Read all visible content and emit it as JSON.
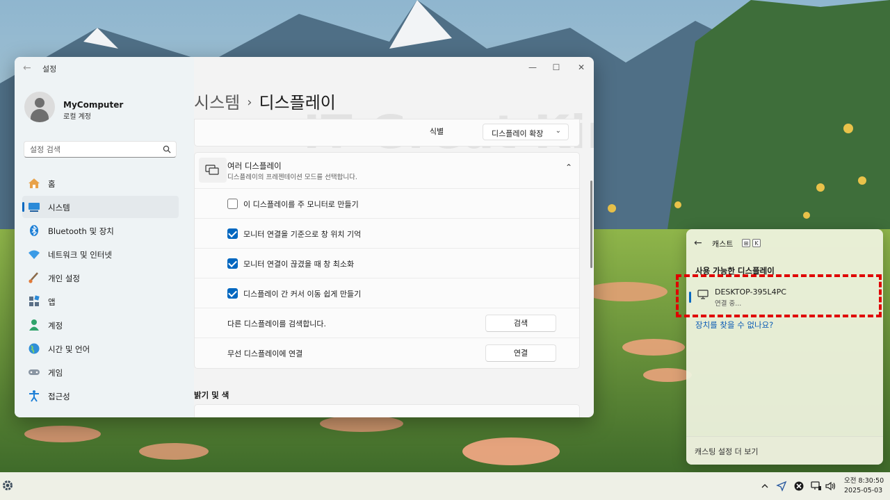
{
  "window": {
    "title": "설정",
    "minimize_glyph": "—",
    "maximize_glyph": "☐",
    "close_glyph": "✕"
  },
  "profile": {
    "name": "MyComputer",
    "account_type": "로컬 계정"
  },
  "search": {
    "placeholder": "설정 검색"
  },
  "nav": {
    "items": [
      {
        "label": "홈",
        "icon": "home-icon",
        "active": false
      },
      {
        "label": "시스템",
        "icon": "system-icon",
        "active": true
      },
      {
        "label": "Bluetooth 및 장치",
        "icon": "bluetooth-icon",
        "active": false
      },
      {
        "label": "네트워크 및 인터넷",
        "icon": "network-icon",
        "active": false
      },
      {
        "label": "개인 설정",
        "icon": "personalization-icon",
        "active": false
      },
      {
        "label": "앱",
        "icon": "apps-icon",
        "active": false
      },
      {
        "label": "계정",
        "icon": "account-icon",
        "active": false
      },
      {
        "label": "시간 및 언어",
        "icon": "globe-icon",
        "active": false
      },
      {
        "label": "게임",
        "icon": "gamepad-icon",
        "active": false
      },
      {
        "label": "접근성",
        "icon": "accessibility-icon",
        "active": false
      }
    ]
  },
  "breadcrumb": {
    "parent": "시스템",
    "separator": "›",
    "current": "디스플레이"
  },
  "watermark": "IT Great King",
  "top_card": {
    "identify_label": "식별",
    "arrangement_value": "디스플레이 확장",
    "chevron": "⌄"
  },
  "multi_display": {
    "title": "여러 디스플레이",
    "subtitle": "디스플레이의 프레젠테이션 모드를 선택합니다.",
    "chevron": "⌃",
    "checkboxes": [
      {
        "label": "이 디스플레이를 주 모니터로 만들기",
        "checked": false
      },
      {
        "label": "모니터 연결을 기준으로 창 위치 기억",
        "checked": true
      },
      {
        "label": "모니터 연결이 끊겼을 때 창 최소화",
        "checked": true
      },
      {
        "label": "디스플레이 간 커서 이동 쉽게 만들기",
        "checked": true
      }
    ],
    "detect": {
      "label": "다른 디스플레이를 검색합니다.",
      "button": "검색"
    },
    "wireless": {
      "label": "무선 디스플레이에 연결",
      "button": "연결"
    }
  },
  "brightness_section": {
    "title": "밝기 및 색"
  },
  "cast": {
    "back_glyph": "←",
    "title": "캐스트",
    "shortcut_keys": [
      "⊞",
      "K"
    ],
    "section_title": "사용 가능한 디스플레이",
    "device": {
      "name": "DESKTOP-395L4PC",
      "status": "연결 중..."
    },
    "help_link": "장치를 찾을 수 없나요?",
    "footer": "캐스팅 설정 더 보기"
  },
  "taskbar": {
    "time": "8:30:50",
    "ampm": "오전",
    "date": "2025-05-03"
  },
  "colors": {
    "accent": "#0067c0",
    "highlight": "#e00000",
    "link": "#0a5bb5"
  }
}
